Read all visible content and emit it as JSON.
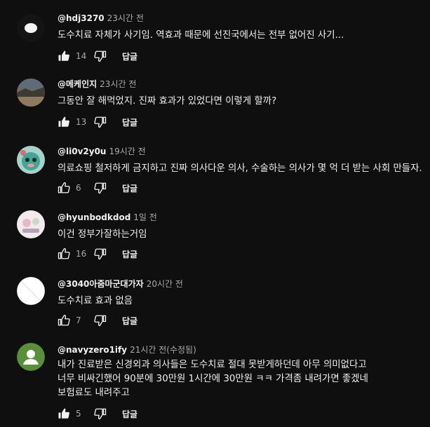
{
  "comments": [
    {
      "author": "@hdj3270",
      "time": "23시간 전",
      "text": "도수치료 자체가 사기임. 역효과 때문에 선진국에서는 전부 없어진 사기...",
      "likes": "14",
      "reply_label": "답글",
      "avatar_icon": "dark-avatar-with-white-oval"
    },
    {
      "author": "@메케인지",
      "time": "23시간 전",
      "text": "그동안 잘 해먹었지. 진짜 효과가 있었다면 이렇게 할까?",
      "likes": "13",
      "reply_label": "답글",
      "avatar_icon": "landscape-photo-avatar"
    },
    {
      "author": "@li0v2y0u",
      "time": "19시간 전",
      "text": "의료쇼핑 철저하게 금지하고 진짜 의사다운 의사, 수술하는 의사가 몇 억 더 받는 사회 만들자.",
      "likes": "6",
      "reply_label": "답글",
      "avatar_icon": "cartoon-character-avatar"
    },
    {
      "author": "@hyunbodkdod",
      "time": "1일 전",
      "text": "이건 정부가잘하는거임",
      "likes": "16",
      "reply_label": "답글",
      "avatar_icon": "pastel-illustration-avatar"
    },
    {
      "author": "@3040아줌마군대가자",
      "time": "20시간 전",
      "text": "도수치료 효과 없음",
      "likes": "7",
      "reply_label": "답글",
      "avatar_icon": "white-circle-avatar"
    },
    {
      "author": "@navyzero1ify",
      "time": "21시간 전(수정됨)",
      "text": "내가 진료받은 신경외과 의사들은 도수치료 절대 못받게하던데 아무 의미없다고\n너무 비싸긴했어 90분에 30만원 1시간에 30만원 ㅋㅋ 가격좀 내려가면 좋겠네\n보험료도 내려주고",
      "likes": "5",
      "reply_label": "답글",
      "avatar_icon": "default-user-avatar"
    }
  ]
}
